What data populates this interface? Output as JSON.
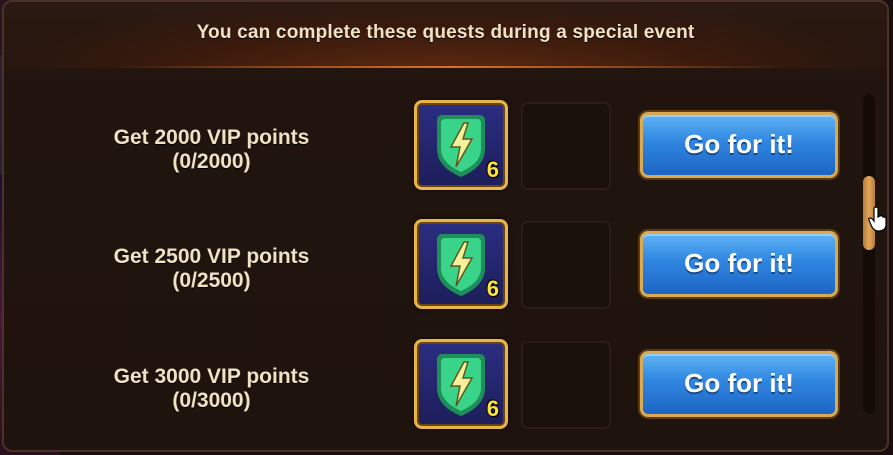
{
  "header": {
    "title": "You can complete these quests during a special event"
  },
  "quests": [
    {
      "label_line1": "Get 2000 VIP points",
      "label_line2": "(0/2000)",
      "reward_icon": "energy-bolt-icon",
      "reward_count": "6",
      "button_label": "Go for it!"
    },
    {
      "label_line1": "Get 2500 VIP points",
      "label_line2": "(0/2500)",
      "reward_icon": "energy-bolt-icon",
      "reward_count": "6",
      "button_label": "Go for it!"
    },
    {
      "label_line1": "Get 3000 VIP points",
      "label_line2": "(0/3000)",
      "reward_icon": "energy-bolt-icon",
      "reward_count": "6",
      "button_label": "Go for it!"
    }
  ],
  "colors": {
    "button_blue": "#2f86e0",
    "frame_gold": "#e8b548",
    "text_cream": "#efe2c4",
    "count_yellow": "#ffe23a"
  }
}
